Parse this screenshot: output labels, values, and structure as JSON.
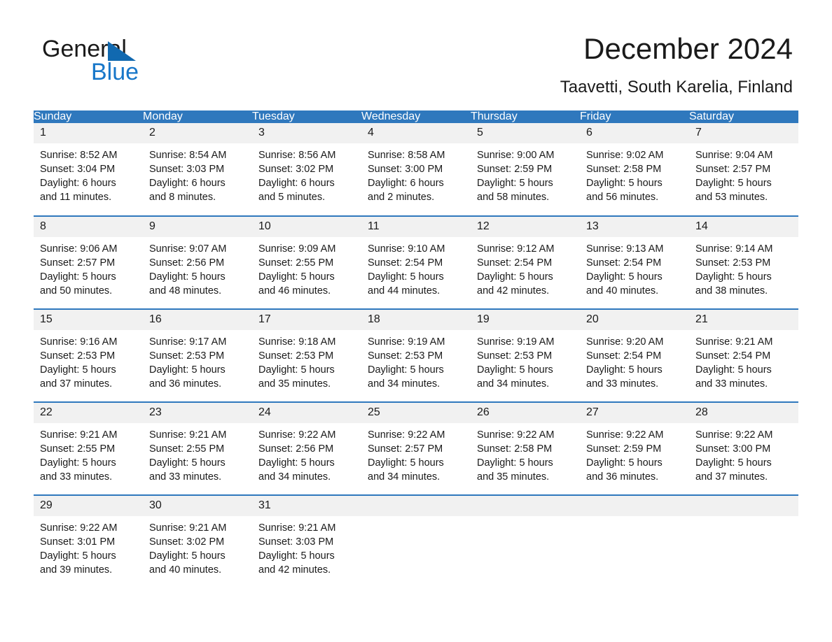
{
  "brand": {
    "name_part1": "General",
    "name_part2": "Blue",
    "triangle_icon": "triangle-logo-icon",
    "accent_color": "#1877c9",
    "logo_blue": "#1169b0"
  },
  "header": {
    "month_title": "December 2024",
    "location": "Taavetti, South Karelia, Finland"
  },
  "calendar": {
    "header_bg": "#2f78bd",
    "daynum_bg": "#f1f1f1",
    "weekday_headers": [
      "Sunday",
      "Monday",
      "Tuesday",
      "Wednesday",
      "Thursday",
      "Friday",
      "Saturday"
    ],
    "weeks": [
      [
        {
          "day": "1",
          "sunrise": "Sunrise: 8:52 AM",
          "sunset": "Sunset: 3:04 PM",
          "daylight_line1": "Daylight: 6 hours",
          "daylight_line2": "and 11 minutes."
        },
        {
          "day": "2",
          "sunrise": "Sunrise: 8:54 AM",
          "sunset": "Sunset: 3:03 PM",
          "daylight_line1": "Daylight: 6 hours",
          "daylight_line2": "and 8 minutes."
        },
        {
          "day": "3",
          "sunrise": "Sunrise: 8:56 AM",
          "sunset": "Sunset: 3:02 PM",
          "daylight_line1": "Daylight: 6 hours",
          "daylight_line2": "and 5 minutes."
        },
        {
          "day": "4",
          "sunrise": "Sunrise: 8:58 AM",
          "sunset": "Sunset: 3:00 PM",
          "daylight_line1": "Daylight: 6 hours",
          "daylight_line2": "and 2 minutes."
        },
        {
          "day": "5",
          "sunrise": "Sunrise: 9:00 AM",
          "sunset": "Sunset: 2:59 PM",
          "daylight_line1": "Daylight: 5 hours",
          "daylight_line2": "and 58 minutes."
        },
        {
          "day": "6",
          "sunrise": "Sunrise: 9:02 AM",
          "sunset": "Sunset: 2:58 PM",
          "daylight_line1": "Daylight: 5 hours",
          "daylight_line2": "and 56 minutes."
        },
        {
          "day": "7",
          "sunrise": "Sunrise: 9:04 AM",
          "sunset": "Sunset: 2:57 PM",
          "daylight_line1": "Daylight: 5 hours",
          "daylight_line2": "and 53 minutes."
        }
      ],
      [
        {
          "day": "8",
          "sunrise": "Sunrise: 9:06 AM",
          "sunset": "Sunset: 2:57 PM",
          "daylight_line1": "Daylight: 5 hours",
          "daylight_line2": "and 50 minutes."
        },
        {
          "day": "9",
          "sunrise": "Sunrise: 9:07 AM",
          "sunset": "Sunset: 2:56 PM",
          "daylight_line1": "Daylight: 5 hours",
          "daylight_line2": "and 48 minutes."
        },
        {
          "day": "10",
          "sunrise": "Sunrise: 9:09 AM",
          "sunset": "Sunset: 2:55 PM",
          "daylight_line1": "Daylight: 5 hours",
          "daylight_line2": "and 46 minutes."
        },
        {
          "day": "11",
          "sunrise": "Sunrise: 9:10 AM",
          "sunset": "Sunset: 2:54 PM",
          "daylight_line1": "Daylight: 5 hours",
          "daylight_line2": "and 44 minutes."
        },
        {
          "day": "12",
          "sunrise": "Sunrise: 9:12 AM",
          "sunset": "Sunset: 2:54 PM",
          "daylight_line1": "Daylight: 5 hours",
          "daylight_line2": "and 42 minutes."
        },
        {
          "day": "13",
          "sunrise": "Sunrise: 9:13 AM",
          "sunset": "Sunset: 2:54 PM",
          "daylight_line1": "Daylight: 5 hours",
          "daylight_line2": "and 40 minutes."
        },
        {
          "day": "14",
          "sunrise": "Sunrise: 9:14 AM",
          "sunset": "Sunset: 2:53 PM",
          "daylight_line1": "Daylight: 5 hours",
          "daylight_line2": "and 38 minutes."
        }
      ],
      [
        {
          "day": "15",
          "sunrise": "Sunrise: 9:16 AM",
          "sunset": "Sunset: 2:53 PM",
          "daylight_line1": "Daylight: 5 hours",
          "daylight_line2": "and 37 minutes."
        },
        {
          "day": "16",
          "sunrise": "Sunrise: 9:17 AM",
          "sunset": "Sunset: 2:53 PM",
          "daylight_line1": "Daylight: 5 hours",
          "daylight_line2": "and 36 minutes."
        },
        {
          "day": "17",
          "sunrise": "Sunrise: 9:18 AM",
          "sunset": "Sunset: 2:53 PM",
          "daylight_line1": "Daylight: 5 hours",
          "daylight_line2": "and 35 minutes."
        },
        {
          "day": "18",
          "sunrise": "Sunrise: 9:19 AM",
          "sunset": "Sunset: 2:53 PM",
          "daylight_line1": "Daylight: 5 hours",
          "daylight_line2": "and 34 minutes."
        },
        {
          "day": "19",
          "sunrise": "Sunrise: 9:19 AM",
          "sunset": "Sunset: 2:53 PM",
          "daylight_line1": "Daylight: 5 hours",
          "daylight_line2": "and 34 minutes."
        },
        {
          "day": "20",
          "sunrise": "Sunrise: 9:20 AM",
          "sunset": "Sunset: 2:54 PM",
          "daylight_line1": "Daylight: 5 hours",
          "daylight_line2": "and 33 minutes."
        },
        {
          "day": "21",
          "sunrise": "Sunrise: 9:21 AM",
          "sunset": "Sunset: 2:54 PM",
          "daylight_line1": "Daylight: 5 hours",
          "daylight_line2": "and 33 minutes."
        }
      ],
      [
        {
          "day": "22",
          "sunrise": "Sunrise: 9:21 AM",
          "sunset": "Sunset: 2:55 PM",
          "daylight_line1": "Daylight: 5 hours",
          "daylight_line2": "and 33 minutes."
        },
        {
          "day": "23",
          "sunrise": "Sunrise: 9:21 AM",
          "sunset": "Sunset: 2:55 PM",
          "daylight_line1": "Daylight: 5 hours",
          "daylight_line2": "and 33 minutes."
        },
        {
          "day": "24",
          "sunrise": "Sunrise: 9:22 AM",
          "sunset": "Sunset: 2:56 PM",
          "daylight_line1": "Daylight: 5 hours",
          "daylight_line2": "and 34 minutes."
        },
        {
          "day": "25",
          "sunrise": "Sunrise: 9:22 AM",
          "sunset": "Sunset: 2:57 PM",
          "daylight_line1": "Daylight: 5 hours",
          "daylight_line2": "and 34 minutes."
        },
        {
          "day": "26",
          "sunrise": "Sunrise: 9:22 AM",
          "sunset": "Sunset: 2:58 PM",
          "daylight_line1": "Daylight: 5 hours",
          "daylight_line2": "and 35 minutes."
        },
        {
          "day": "27",
          "sunrise": "Sunrise: 9:22 AM",
          "sunset": "Sunset: 2:59 PM",
          "daylight_line1": "Daylight: 5 hours",
          "daylight_line2": "and 36 minutes."
        },
        {
          "day": "28",
          "sunrise": "Sunrise: 9:22 AM",
          "sunset": "Sunset: 3:00 PM",
          "daylight_line1": "Daylight: 5 hours",
          "daylight_line2": "and 37 minutes."
        }
      ],
      [
        {
          "day": "29",
          "sunrise": "Sunrise: 9:22 AM",
          "sunset": "Sunset: 3:01 PM",
          "daylight_line1": "Daylight: 5 hours",
          "daylight_line2": "and 39 minutes."
        },
        {
          "day": "30",
          "sunrise": "Sunrise: 9:21 AM",
          "sunset": "Sunset: 3:02 PM",
          "daylight_line1": "Daylight: 5 hours",
          "daylight_line2": "and 40 minutes."
        },
        {
          "day": "31",
          "sunrise": "Sunrise: 9:21 AM",
          "sunset": "Sunset: 3:03 PM",
          "daylight_line1": "Daylight: 5 hours",
          "daylight_line2": "and 42 minutes."
        },
        {
          "day": "",
          "sunrise": "",
          "sunset": "",
          "daylight_line1": "",
          "daylight_line2": ""
        },
        {
          "day": "",
          "sunrise": "",
          "sunset": "",
          "daylight_line1": "",
          "daylight_line2": ""
        },
        {
          "day": "",
          "sunrise": "",
          "sunset": "",
          "daylight_line1": "",
          "daylight_line2": ""
        },
        {
          "day": "",
          "sunrise": "",
          "sunset": "",
          "daylight_line1": "",
          "daylight_line2": ""
        }
      ]
    ]
  }
}
